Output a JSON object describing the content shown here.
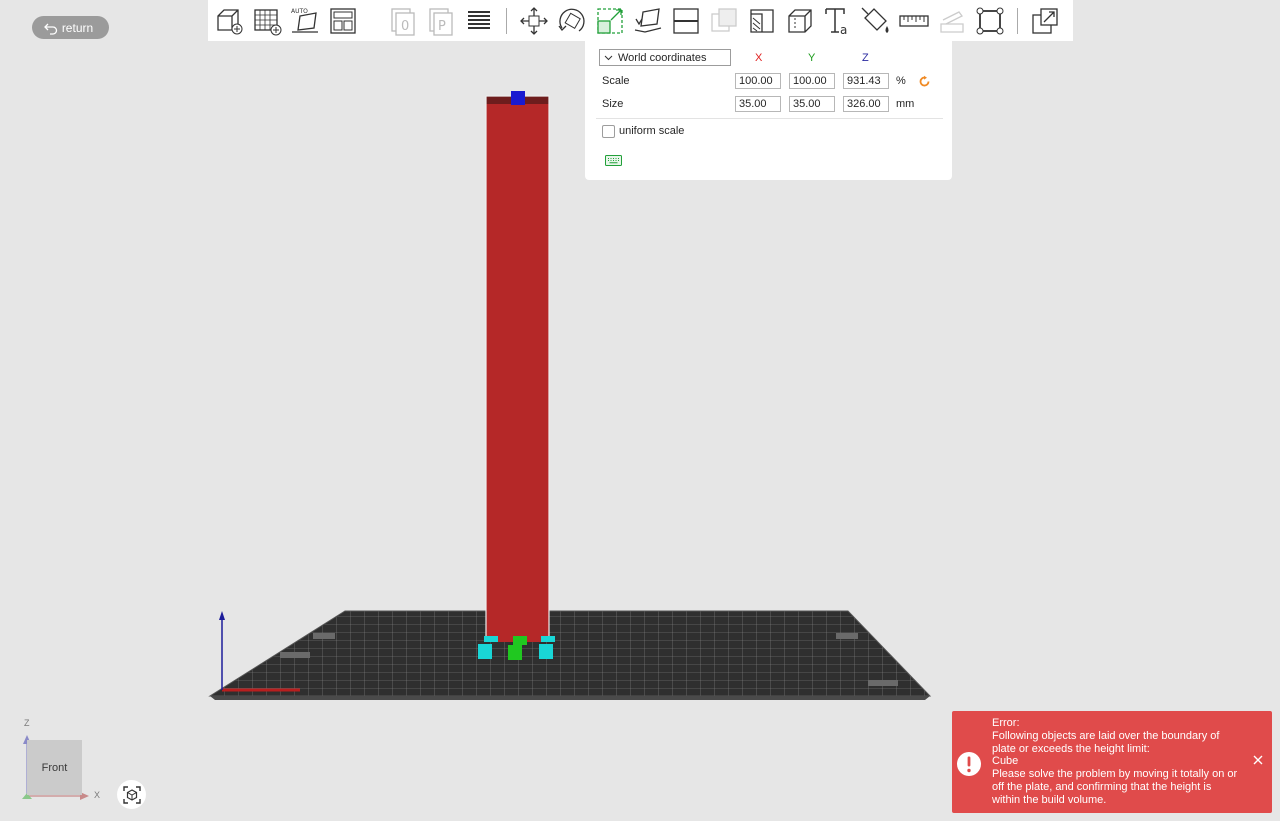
{
  "header": {
    "return_label": "return"
  },
  "toolbar": {
    "groups": [
      [
        "add-object-icon",
        "add-plate-icon",
        "auto-orient-icon",
        "arrange-icon"
      ],
      [
        "copy-object-icon",
        "paste-object-icon",
        "layers-icon"
      ],
      [
        "move-icon",
        "rotate-icon",
        "scale-icon",
        "lay-on-face-icon",
        "cut-icon",
        "boolean-icon",
        "support-paint-icon",
        "seam-paint-icon",
        "text-icon",
        "color-paint-icon",
        "measure-icon",
        "assembly-icon",
        "fit-icon"
      ],
      [
        "split-icon"
      ]
    ]
  },
  "scale_panel": {
    "coordinate_mode": "World coordinates",
    "axes": [
      "X",
      "Y",
      "Z"
    ],
    "axis_colors": [
      "#e02020",
      "#1a9b1a",
      "#2a2aa0"
    ],
    "scale_label": "Scale",
    "scale_values": [
      "100.00",
      "100.00",
      "931.43"
    ],
    "scale_unit": "%",
    "size_label": "Size",
    "size_values": [
      "35.00",
      "35.00",
      "326.00"
    ],
    "size_unit": "mm",
    "uniform_scale_label": "uniform scale",
    "uniform_scale_checked": false
  },
  "view": {
    "cube_face_label": "Front",
    "axis_z_label": "Z",
    "axis_x_label": "X"
  },
  "error": {
    "lines": [
      "Error:",
      "Following objects are laid over the boundary of plate or exceeds the height limit:",
      "Cube",
      "Please solve the problem by moving it totally on or off the plate, and confirming that the height is within the build volume."
    ]
  },
  "colors": {
    "object": "#b52828",
    "accent": "#f08a24",
    "error": "#e04b4b"
  }
}
